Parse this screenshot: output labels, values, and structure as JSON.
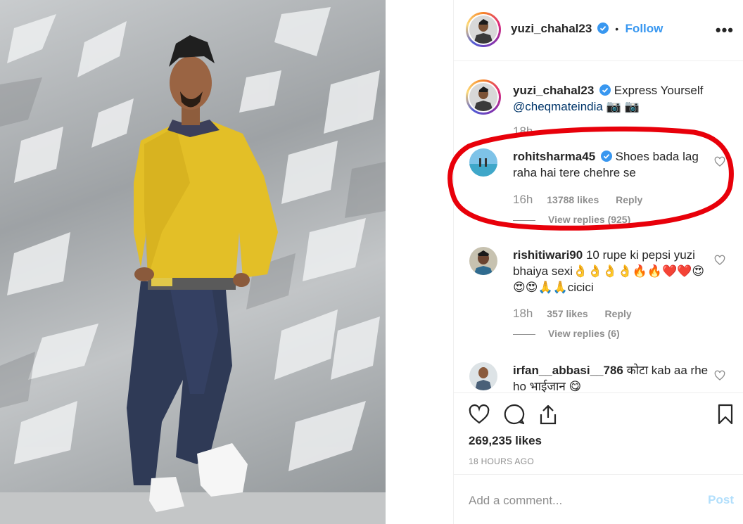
{
  "post": {
    "author": "yuzi_chahal23",
    "follow_label": "Follow",
    "dot": "•",
    "more_label": "•••"
  },
  "caption": {
    "username": "yuzi_chahal23",
    "text": "Express Yourself",
    "mention": "@cheqmateindia",
    "emoji": "📷 📷",
    "time": "18h"
  },
  "comments": [
    {
      "username": "rohitsharma45",
      "text": "Shoes bada lag raha hai tere chehre se",
      "time": "16h",
      "likes": "13788 likes",
      "reply_label": "Reply",
      "view_replies": "View replies (925)"
    },
    {
      "username": "rishitiwari90",
      "text": "10 rupe ki pepsi yuzi bhaiya sexi👌👌👌👌🔥🔥❤️❤️😍😍😍🙏🙏cicici",
      "time": "18h",
      "likes": "357 likes",
      "reply_label": "Reply",
      "view_replies": "View replies (6)"
    },
    {
      "username": "irfan__abbasi__786",
      "text": "कोटा kab aa rhe ho भाईजान 😋"
    }
  ],
  "actions": {
    "likes": "269,235 likes",
    "timestamp": "18 HOURS AGO"
  },
  "add_comment": {
    "placeholder": "Add a comment...",
    "post_label": "Post"
  },
  "colors": {
    "link": "#3897f0",
    "annotation": "#e8000a",
    "sweater": "#e6c22b"
  },
  "icons": [
    "heart-icon",
    "comment-icon",
    "share-icon",
    "bookmark-icon",
    "verified-icon",
    "more-icon"
  ]
}
